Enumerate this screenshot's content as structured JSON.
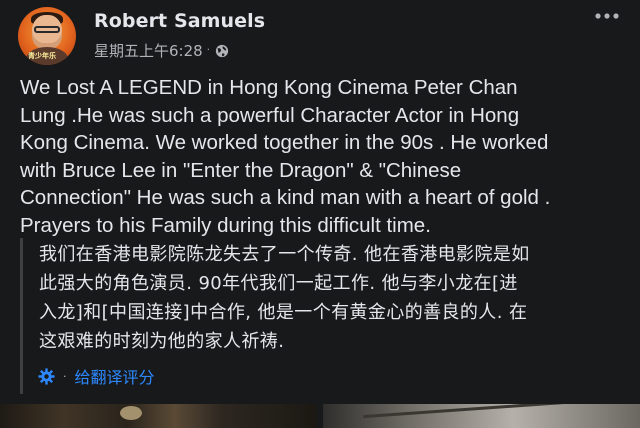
{
  "post": {
    "author": "Robert Samuels",
    "timestamp": "星期五上午6:28",
    "separator": "·",
    "privacy_icon": "globe-icon",
    "more_icon": "ellipsis-icon",
    "avatar_badge": "青少年乐",
    "body_lines": [
      "We Lost A LEGEND in Hong Kong Cinema Peter Chan",
      "Lung .He was such a powerful Character Actor in Hong",
      "Kong Cinema. We worked together in the 90s . He worked",
      "with Bruce Lee in \"Enter the Dragon\" & \"Chinese",
      "Connection\" He was such a kind man with a heart of gold .",
      "Prayers to his Family during this difficult time."
    ],
    "translation": {
      "lines": [
        "我们在香港电影院陈龙失去了一个传奇. 他在香港电影院是如",
        "此强大的角色演员. 90年代我们一起工作. 他与李小龙在[进",
        "入龙]和[中国连接]中合作, 他是一个有黄金心的善良的人. 在",
        "这艰难的时刻为他的家人祈祷."
      ],
      "settings_icon": "gear-icon",
      "separator": "·",
      "rate_label": "给翻译评分"
    }
  },
  "colors": {
    "background": "#18191a",
    "text_primary": "#e4e6eb",
    "text_secondary": "#b0b3b8",
    "link": "#2d88ff"
  }
}
